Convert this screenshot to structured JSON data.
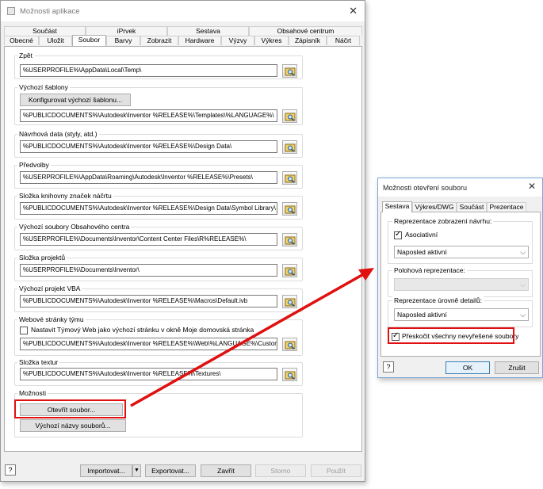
{
  "main_window": {
    "title": "Možnosti aplikace",
    "tabs_row1": [
      "Součást",
      "iPrvek",
      "Sestava",
      "Obsahové centrum"
    ],
    "tabs_row2": [
      "Obecné",
      "Uložit",
      "Soubor",
      "Barvy",
      "Zobrazit",
      "Hardware",
      "Výzvy",
      "Výkres",
      "Zápisník",
      "Náčrt"
    ],
    "active_tab": "Soubor",
    "groups": [
      {
        "label": "Zpět",
        "value": "%USERPROFILE%\\AppData\\Local\\Temp\\"
      },
      {
        "label": "Výchozí šablony",
        "button": "Konfigurovat výchozí šablonu...",
        "value": "%PUBLICDOCUMENTS%\\Autodesk\\Inventor %RELEASE%\\Templates\\%LANGUAGE%\\"
      },
      {
        "label": "Návrhová data (styly, atd.)",
        "value": "%PUBLICDOCUMENTS%\\Autodesk\\Inventor %RELEASE%\\Design Data\\"
      },
      {
        "label": "Předvolby",
        "value": "%USERPROFILE%\\AppData\\Roaming\\Autodesk\\Inventor %RELEASE%\\Presets\\"
      },
      {
        "label": "Složka knihovny značek náčrtu",
        "value": "%PUBLICDOCUMENTS%\\Autodesk\\Inventor %RELEASE%\\Design Data\\Symbol Library\\"
      },
      {
        "label": "Výchozí soubory Obsahového centra",
        "value": "%USERPROFILE%\\Documents\\Inventor\\Content Center Files\\R%RELEASE%\\"
      },
      {
        "label": "Složka projektů",
        "value": "%USERPROFILE%\\Documents\\Inventor\\"
      },
      {
        "label": "Výchozí projekt VBA",
        "value": "%PUBLICDOCUMENTS%\\Autodesk\\Inventor %RELEASE%\\Macros\\Default.ivb"
      },
      {
        "label": "Webové stránky týmu",
        "checkbox": "Nastavit Týmový Web jako výchozí stránku v okně Moje domovská stránka",
        "value": "%PUBLICDOCUMENTS%\\Autodesk\\Inventor %RELEASE%\\Web\\%LANGUAGE%\\Custom"
      },
      {
        "label": "Složka textur",
        "value": "%PUBLICDOCUMENTS%\\Autodesk\\Inventor %RELEASE%\\Textures\\"
      }
    ],
    "options_group": {
      "label": "Možnosti",
      "open_file_button": "Otevřít soubor...",
      "default_names_button": "Výchozí názvy souborů..."
    },
    "footer": {
      "import": "Importovat...",
      "export": "Exportovat...",
      "close": "Zavřít",
      "cancel": "Storno",
      "apply": "Použít"
    }
  },
  "open_dialog": {
    "title": "Možnosti otevření souboru",
    "tabs": [
      "Sestava",
      "Výkres/DWG",
      "Součást",
      "Prezentace"
    ],
    "active_tab": "Sestava",
    "design_view": {
      "label": "Reprezentace zobrazení návrhu:",
      "checkbox": "Asociativní",
      "checked": true,
      "select": "Naposled aktivní"
    },
    "positional": {
      "label": "Polohová reprezentace:",
      "select": ""
    },
    "lod": {
      "label": "Reprezentace úrovně detailů:",
      "select": "Naposled aktivní"
    },
    "skip_unresolved": {
      "label": "Přeskočit všechny nevyřešené soubory",
      "checked": true
    },
    "ok": "OK",
    "cancel": "Zrušit"
  },
  "colors": {
    "highlight": "#e01010"
  }
}
